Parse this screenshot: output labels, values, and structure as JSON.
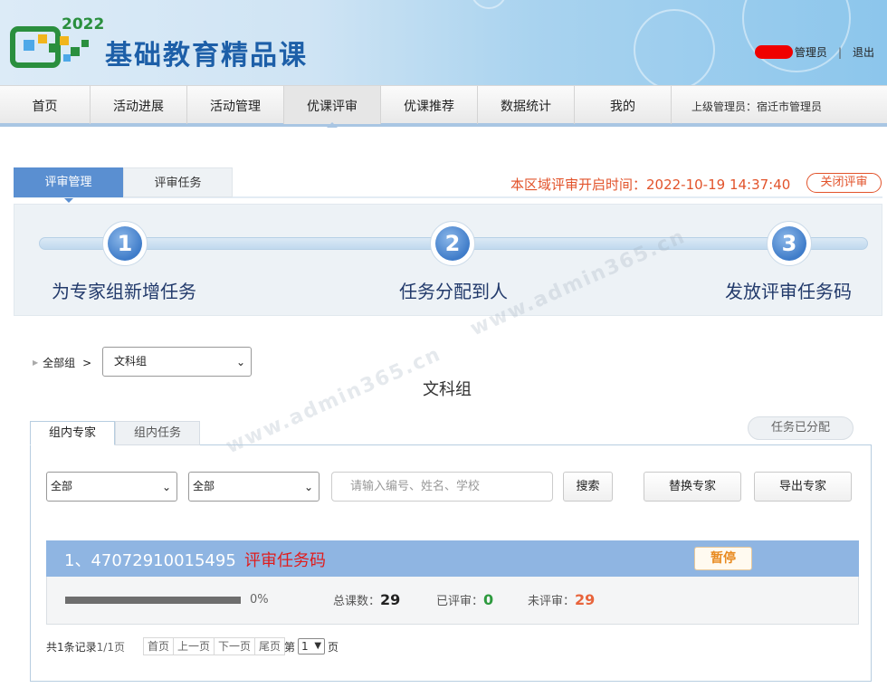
{
  "header": {
    "logo_year": "2022",
    "logo_title": "基础教育精品课",
    "user_role": "管理员",
    "user_sep": "|",
    "logout": "退出"
  },
  "nav": {
    "items": [
      "首页",
      "活动进展",
      "活动管理",
      "优课评审",
      "优课推荐",
      "数据统计",
      "我的"
    ],
    "active_index": 3,
    "supervisor": "上级管理员：宿迁市管理员"
  },
  "review_tabs": {
    "active": "评审管理",
    "inactive": "评审任务"
  },
  "open_time": "本区域评审开启时间：2022-10-19 14:37:40",
  "close_review": "关闭评审",
  "steps": [
    {
      "num": "1",
      "label": "为专家组新增任务"
    },
    {
      "num": "2",
      "label": "任务分配到人"
    },
    {
      "num": "3",
      "label": "发放评审任务码"
    }
  ],
  "breadcrumb": {
    "root": "全部组",
    "sep": ">",
    "group_select": "文科组"
  },
  "group_title": "文科组",
  "watermark": "www.admin365.cn",
  "inner_tabs": {
    "active": "组内专家",
    "inactive": "组内任务"
  },
  "assigned_badge": "任务已分配",
  "filters": {
    "select1": "全部",
    "select2": "全部",
    "search_placeholder": "请输入编号、姓名、学校",
    "search_button": "搜索",
    "replace_button": "替换专家",
    "export_button": "导出专家"
  },
  "task": {
    "id": "1、47072910015495",
    "code_label": "评审任务码",
    "pause": "暂停",
    "progress": 0,
    "progress_label": "0%",
    "total_label": "总课数：",
    "total": "29",
    "done_label": "已评审：",
    "done": "0",
    "pending_label": "未评审：",
    "pending": "29"
  },
  "pager": {
    "summary_a": "共1条记录",
    "summary_b": "1/1页",
    "first": "首页",
    "prev": "上一页",
    "next": "下一页",
    "last": "尾页",
    "page_prefix": "第",
    "page_value": "1",
    "page_suffix": "页"
  },
  "colors": {
    "accent": "#5a8fd1",
    "orange": "#e2532b",
    "done_green": "#2d9a3e",
    "pending_red": "#e8643c"
  }
}
